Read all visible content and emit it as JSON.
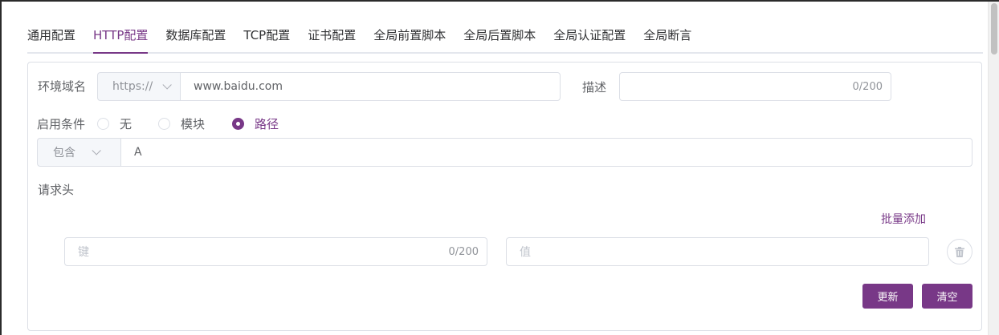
{
  "tabs": [
    {
      "label": "通用配置"
    },
    {
      "label": "HTTP配置"
    },
    {
      "label": "数据库配置"
    },
    {
      "label": "TCP配置"
    },
    {
      "label": "证书配置"
    },
    {
      "label": "全局前置脚本"
    },
    {
      "label": "全局后置脚本"
    },
    {
      "label": "全局认证配置"
    },
    {
      "label": "全局断言"
    }
  ],
  "active_tab_index": 1,
  "accent_color": "#783887",
  "env_domain": {
    "label": "环境域名",
    "protocol": "https://",
    "value": "www.baidu.com"
  },
  "description": {
    "label": "描述",
    "value": "",
    "count": "0/200"
  },
  "enable_condition": {
    "label": "启用条件",
    "options": [
      "无",
      "模块",
      "路径"
    ],
    "selected": "路径"
  },
  "path_condition": {
    "operator": "包含",
    "value": "A"
  },
  "request_headers": {
    "label": "请求头",
    "batch_add_label": "批量添加",
    "key_placeholder": "键",
    "key_count": "0/200",
    "value_placeholder": "值",
    "delete_icon": "trash-icon"
  },
  "actions": {
    "update_label": "更新",
    "clear_label": "清空"
  }
}
